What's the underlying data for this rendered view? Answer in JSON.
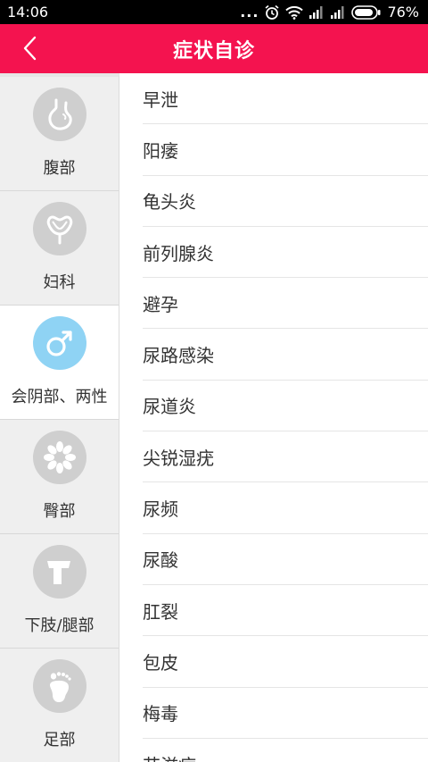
{
  "status_bar": {
    "time": "14:06",
    "dots": "...",
    "battery": "76%"
  },
  "header": {
    "title": "症状自诊"
  },
  "sidebar": {
    "items": [
      {
        "label": "腹部"
      },
      {
        "label": "妇科"
      },
      {
        "label": "会阴部、两性",
        "active": true
      },
      {
        "label": "臀部"
      },
      {
        "label": "下肢/腿部"
      },
      {
        "label": "足部"
      }
    ]
  },
  "symptoms": [
    "早泄",
    "阳痿",
    "龟头炎",
    "前列腺炎",
    "避孕",
    "尿路感染",
    "尿道炎",
    "尖锐湿疣",
    "尿频",
    "尿酸",
    "肛裂",
    "包皮",
    "梅毒",
    "艾滋病"
  ],
  "colors": {
    "header": "#f4134f",
    "active_icon": "#8fd3f4",
    "inactive_icon": "#cfcfcf",
    "sidebar_bg": "#efefef"
  }
}
